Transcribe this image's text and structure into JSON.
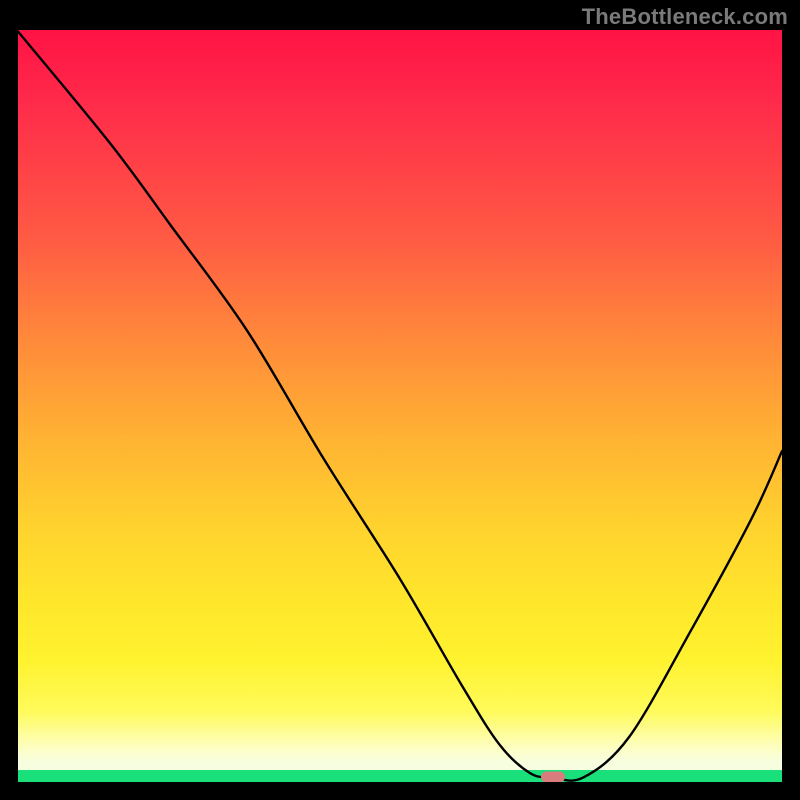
{
  "watermark": {
    "text": "TheBottleneck.com"
  },
  "colors": {
    "page_bg": "#000000",
    "watermark_text": "#7a7a7a",
    "gradient_stops": [
      "#ff1345",
      "#ff2b4a",
      "#ff5a44",
      "#ff8a3a",
      "#ffb233",
      "#ffd22e",
      "#ffe62c",
      "#fff22e",
      "#fffb5a",
      "#fdfec2",
      "#f7fee0"
    ],
    "bottom_band": "#19e07a",
    "curve_stroke": "#000000",
    "optimum_marker": "#d87d7d"
  },
  "chart_data": {
    "type": "line",
    "title": "",
    "xlabel": "",
    "ylabel": "",
    "xlim": [
      0,
      100
    ],
    "ylim": [
      0,
      100
    ],
    "grid": false,
    "legend": false,
    "series": [
      {
        "name": "bottleneck-curve",
        "x": [
          0,
          12,
          20,
          30,
          40,
          50,
          58,
          63,
          67,
          70,
          74,
          80,
          88,
          96,
          100
        ],
        "y": [
          99.8,
          85,
          74,
          60,
          43,
          27,
          13,
          5,
          1.2,
          0.6,
          0.6,
          6,
          20,
          35,
          44
        ]
      }
    ],
    "annotations": [
      {
        "name": "optimum-marker",
        "x": 70,
        "y": 0.7
      }
    ],
    "notes": "y represents bottleneck severity (percent), encoded visually by background color band from green (low) through yellow/orange to red (high). The black curve shows severity vs. implicit x-axis parameter; the small pink pill marks the minimum near x≈70."
  }
}
